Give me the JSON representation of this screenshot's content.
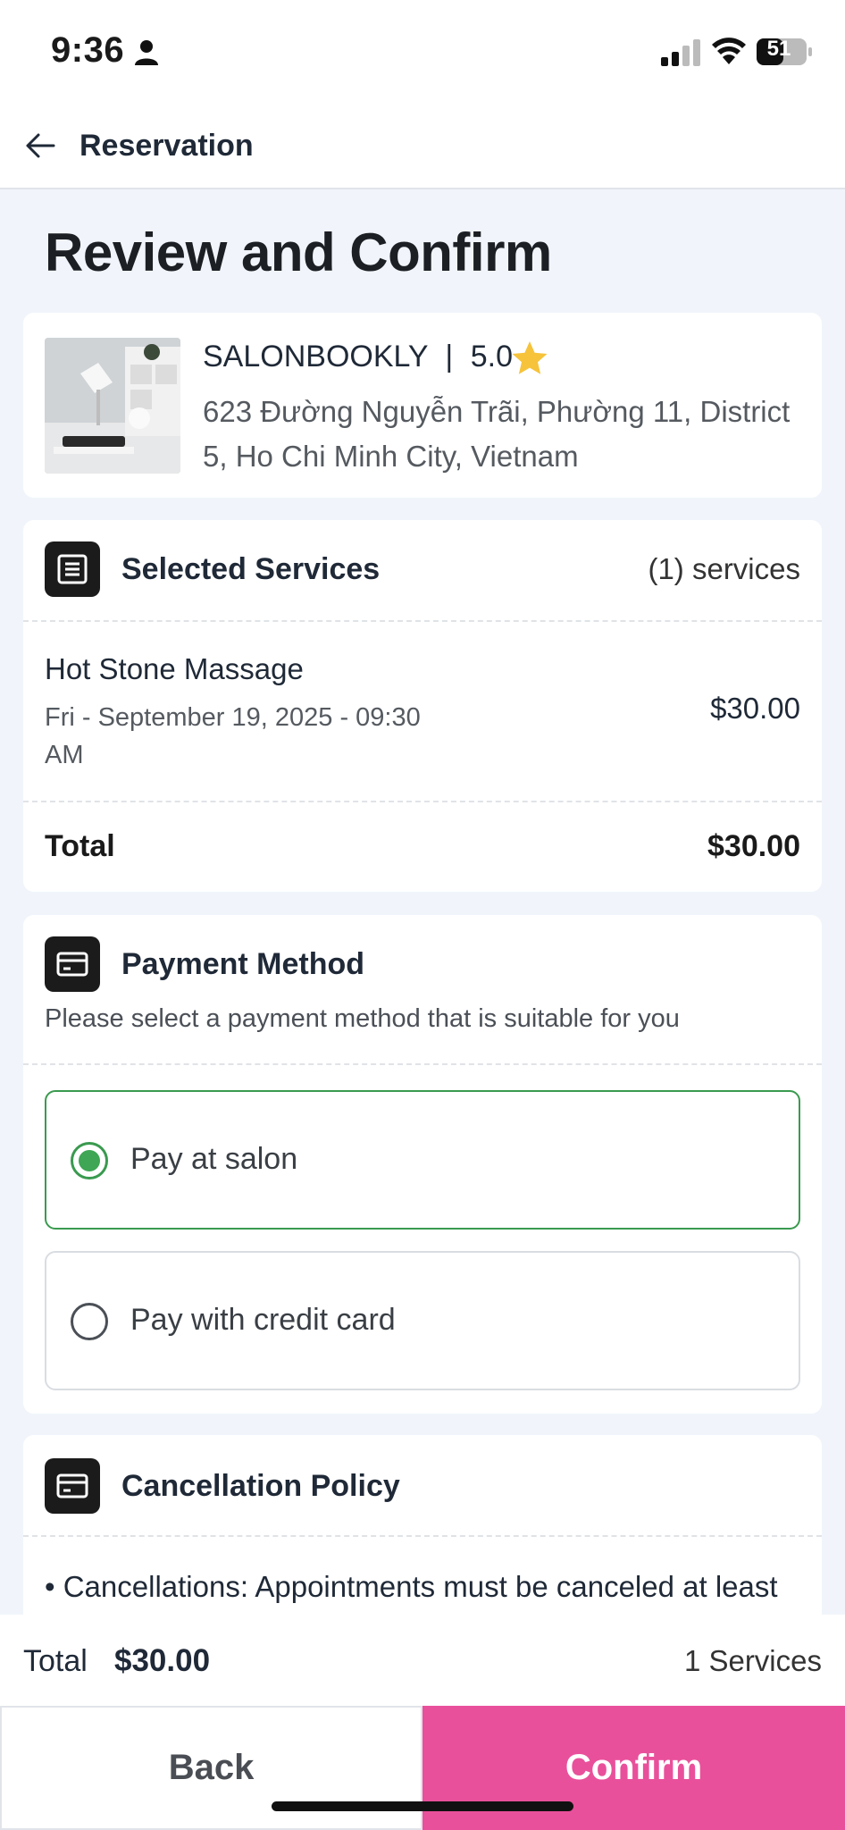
{
  "status_bar": {
    "time": "9:36",
    "battery": "51"
  },
  "header": {
    "title": "Reservation"
  },
  "page_title": "Review and Confirm",
  "salon": {
    "name": "SALONBOOKLY",
    "separator": "|",
    "rating": "5.0",
    "address": "623 Đường Nguyễn Trãi, Phường 11, District 5, Ho Chi Minh City, Vietnam"
  },
  "services": {
    "title": "Selected Services",
    "count": "(1) services",
    "items": [
      {
        "name": "Hot Stone Massage",
        "datetime": "Fri - September 19, 2025 - 09:30 AM",
        "price": "$30.00"
      }
    ],
    "total_label": "Total",
    "total_value": "$30.00"
  },
  "payment": {
    "title": "Payment Method",
    "subtitle": "Please select a payment method that is suitable for you",
    "options": [
      {
        "label": "Pay at salon",
        "selected": true
      },
      {
        "label": "Pay with credit card",
        "selected": false
      }
    ]
  },
  "cancellation": {
    "title": "Cancellation Policy",
    "text": "• Cancellations: Appointments must be canceled at least"
  },
  "footer": {
    "total_label": "Total",
    "total_value": "$30.00",
    "services_count": "1 Services",
    "back_label": "Back",
    "confirm_label": "Confirm"
  },
  "colors": {
    "accent_pink": "#e9509b",
    "selected_green": "#3a9a4f",
    "star": "#f6c33b",
    "background": "#f1f5fb"
  },
  "icons": [
    "person-icon",
    "signal-icon",
    "wifi-icon",
    "battery-icon",
    "back-arrow-icon",
    "star-icon",
    "list-icon",
    "card-icon"
  ]
}
